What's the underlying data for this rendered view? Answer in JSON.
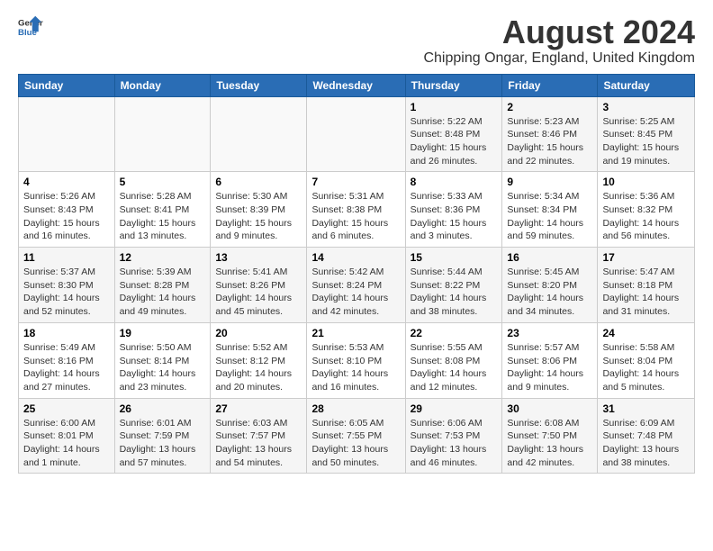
{
  "header": {
    "logo_general": "General",
    "logo_blue": "Blue",
    "month_year": "August 2024",
    "location": "Chipping Ongar, England, United Kingdom"
  },
  "columns": [
    "Sunday",
    "Monday",
    "Tuesday",
    "Wednesday",
    "Thursday",
    "Friday",
    "Saturday"
  ],
  "weeks": [
    {
      "days": [
        {
          "num": "",
          "info": ""
        },
        {
          "num": "",
          "info": ""
        },
        {
          "num": "",
          "info": ""
        },
        {
          "num": "",
          "info": ""
        },
        {
          "num": "1",
          "info": "Sunrise: 5:22 AM\nSunset: 8:48 PM\nDaylight: 15 hours\nand 26 minutes."
        },
        {
          "num": "2",
          "info": "Sunrise: 5:23 AM\nSunset: 8:46 PM\nDaylight: 15 hours\nand 22 minutes."
        },
        {
          "num": "3",
          "info": "Sunrise: 5:25 AM\nSunset: 8:45 PM\nDaylight: 15 hours\nand 19 minutes."
        }
      ]
    },
    {
      "days": [
        {
          "num": "4",
          "info": "Sunrise: 5:26 AM\nSunset: 8:43 PM\nDaylight: 15 hours\nand 16 minutes."
        },
        {
          "num": "5",
          "info": "Sunrise: 5:28 AM\nSunset: 8:41 PM\nDaylight: 15 hours\nand 13 minutes."
        },
        {
          "num": "6",
          "info": "Sunrise: 5:30 AM\nSunset: 8:39 PM\nDaylight: 15 hours\nand 9 minutes."
        },
        {
          "num": "7",
          "info": "Sunrise: 5:31 AM\nSunset: 8:38 PM\nDaylight: 15 hours\nand 6 minutes."
        },
        {
          "num": "8",
          "info": "Sunrise: 5:33 AM\nSunset: 8:36 PM\nDaylight: 15 hours\nand 3 minutes."
        },
        {
          "num": "9",
          "info": "Sunrise: 5:34 AM\nSunset: 8:34 PM\nDaylight: 14 hours\nand 59 minutes."
        },
        {
          "num": "10",
          "info": "Sunrise: 5:36 AM\nSunset: 8:32 PM\nDaylight: 14 hours\nand 56 minutes."
        }
      ]
    },
    {
      "days": [
        {
          "num": "11",
          "info": "Sunrise: 5:37 AM\nSunset: 8:30 PM\nDaylight: 14 hours\nand 52 minutes."
        },
        {
          "num": "12",
          "info": "Sunrise: 5:39 AM\nSunset: 8:28 PM\nDaylight: 14 hours\nand 49 minutes."
        },
        {
          "num": "13",
          "info": "Sunrise: 5:41 AM\nSunset: 8:26 PM\nDaylight: 14 hours\nand 45 minutes."
        },
        {
          "num": "14",
          "info": "Sunrise: 5:42 AM\nSunset: 8:24 PM\nDaylight: 14 hours\nand 42 minutes."
        },
        {
          "num": "15",
          "info": "Sunrise: 5:44 AM\nSunset: 8:22 PM\nDaylight: 14 hours\nand 38 minutes."
        },
        {
          "num": "16",
          "info": "Sunrise: 5:45 AM\nSunset: 8:20 PM\nDaylight: 14 hours\nand 34 minutes."
        },
        {
          "num": "17",
          "info": "Sunrise: 5:47 AM\nSunset: 8:18 PM\nDaylight: 14 hours\nand 31 minutes."
        }
      ]
    },
    {
      "days": [
        {
          "num": "18",
          "info": "Sunrise: 5:49 AM\nSunset: 8:16 PM\nDaylight: 14 hours\nand 27 minutes."
        },
        {
          "num": "19",
          "info": "Sunrise: 5:50 AM\nSunset: 8:14 PM\nDaylight: 14 hours\nand 23 minutes."
        },
        {
          "num": "20",
          "info": "Sunrise: 5:52 AM\nSunset: 8:12 PM\nDaylight: 14 hours\nand 20 minutes."
        },
        {
          "num": "21",
          "info": "Sunrise: 5:53 AM\nSunset: 8:10 PM\nDaylight: 14 hours\nand 16 minutes."
        },
        {
          "num": "22",
          "info": "Sunrise: 5:55 AM\nSunset: 8:08 PM\nDaylight: 14 hours\nand 12 minutes."
        },
        {
          "num": "23",
          "info": "Sunrise: 5:57 AM\nSunset: 8:06 PM\nDaylight: 14 hours\nand 9 minutes."
        },
        {
          "num": "24",
          "info": "Sunrise: 5:58 AM\nSunset: 8:04 PM\nDaylight: 14 hours\nand 5 minutes."
        }
      ]
    },
    {
      "days": [
        {
          "num": "25",
          "info": "Sunrise: 6:00 AM\nSunset: 8:01 PM\nDaylight: 14 hours\nand 1 minute."
        },
        {
          "num": "26",
          "info": "Sunrise: 6:01 AM\nSunset: 7:59 PM\nDaylight: 13 hours\nand 57 minutes."
        },
        {
          "num": "27",
          "info": "Sunrise: 6:03 AM\nSunset: 7:57 PM\nDaylight: 13 hours\nand 54 minutes."
        },
        {
          "num": "28",
          "info": "Sunrise: 6:05 AM\nSunset: 7:55 PM\nDaylight: 13 hours\nand 50 minutes."
        },
        {
          "num": "29",
          "info": "Sunrise: 6:06 AM\nSunset: 7:53 PM\nDaylight: 13 hours\nand 46 minutes."
        },
        {
          "num": "30",
          "info": "Sunrise: 6:08 AM\nSunset: 7:50 PM\nDaylight: 13 hours\nand 42 minutes."
        },
        {
          "num": "31",
          "info": "Sunrise: 6:09 AM\nSunset: 7:48 PM\nDaylight: 13 hours\nand 38 minutes."
        }
      ]
    }
  ]
}
